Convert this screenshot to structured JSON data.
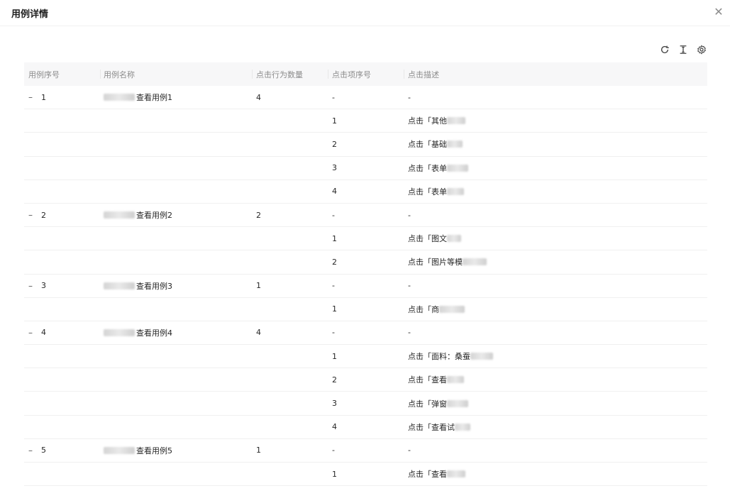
{
  "modal": {
    "title": "用例详情",
    "close_icon": "close-icon"
  },
  "toolbar": {
    "icons": [
      "refresh-icon",
      "column-height-icon",
      "settings-icon"
    ]
  },
  "table": {
    "columns": [
      "用例序号",
      "用例名称",
      "点击行为数量",
      "点击项序号",
      "点击描述"
    ],
    "rows": [
      {
        "seq": "1",
        "name": "查看用例1",
        "count": "4",
        "item": "-",
        "desc": "-",
        "parent": true
      },
      {
        "item": "1",
        "desc": "点击「其他"
      },
      {
        "item": "2",
        "desc": "点击「基础"
      },
      {
        "item": "3",
        "desc": "点击「表单"
      },
      {
        "item": "4",
        "desc": "点击「表单"
      },
      {
        "seq": "2",
        "name": "查看用例2",
        "count": "2",
        "item": "-",
        "desc": "-",
        "parent": true
      },
      {
        "item": "1",
        "desc": "点击「图文"
      },
      {
        "item": "2",
        "desc": "点击「图片等模"
      },
      {
        "seq": "3",
        "name": "查看用例3",
        "count": "1",
        "item": "-",
        "desc": "-",
        "parent": true
      },
      {
        "item": "1",
        "desc": "点击「商"
      },
      {
        "seq": "4",
        "name": "查看用例4",
        "count": "4",
        "item": "-",
        "desc": "-",
        "parent": true
      },
      {
        "item": "1",
        "desc": "点击「面料：桑蚕"
      },
      {
        "item": "2",
        "desc": "点击「查看"
      },
      {
        "item": "3",
        "desc": "点击「弹窗"
      },
      {
        "item": "4",
        "desc": "点击「查看试"
      },
      {
        "seq": "5",
        "name": "查看用例5",
        "count": "1",
        "item": "-",
        "desc": "-",
        "parent": true
      },
      {
        "item": "1",
        "desc": "点击「查看"
      }
    ]
  },
  "expand_symbol": "–"
}
